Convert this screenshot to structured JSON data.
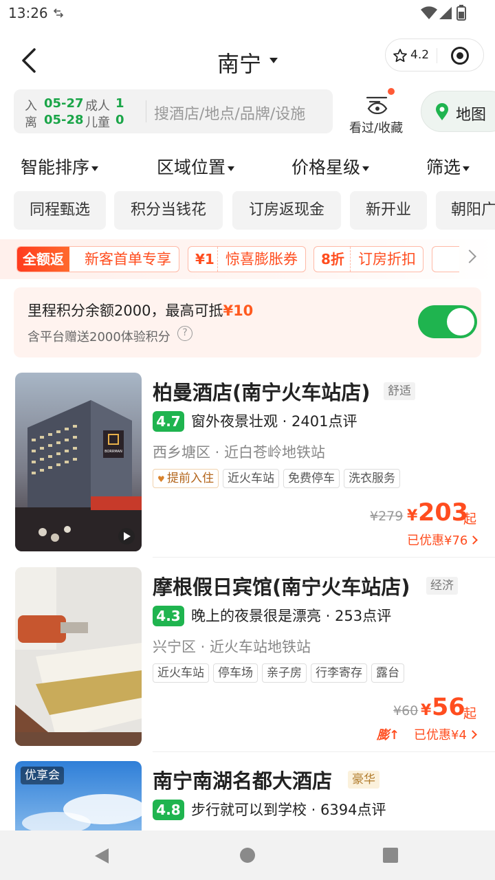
{
  "status_bar": {
    "time": "13:26"
  },
  "header": {
    "city": "南宁",
    "rating": "4.2"
  },
  "search": {
    "checkin_label": "入",
    "checkin_date": "05-27",
    "checkout_label": "离",
    "checkout_date": "05-28",
    "adult_label": "成人",
    "adult_count": "1",
    "child_label": "儿童",
    "child_count": "0",
    "placeholder": "搜酒店/地点/品牌/设施"
  },
  "favorites": {
    "label": "看过/收藏"
  },
  "map": {
    "label": "地图"
  },
  "sort_bar": [
    {
      "label": "智能排序"
    },
    {
      "label": "区域位置"
    },
    {
      "label": "价格星级"
    },
    {
      "label": "筛选"
    }
  ],
  "chips": [
    {
      "label": "同程甄选"
    },
    {
      "label": "积分当钱花"
    },
    {
      "label": "订房返现金"
    },
    {
      "label": "新开业"
    },
    {
      "label": "朝阳广"
    }
  ],
  "promos": [
    {
      "badge": "全额返",
      "text": "新客首单专享"
    },
    {
      "badge": "¥1",
      "text": "惊喜膨胀券"
    },
    {
      "badge": "8折",
      "text": "订房折扣"
    }
  ],
  "points": {
    "text_prefix": "里程积分余额2000，最高可抵",
    "highlight": "¥10",
    "sub": "含平台赠送2000体验积分",
    "toggle_on": true
  },
  "hotels": [
    {
      "name": "柏曼酒店(南宁火车站店)",
      "tier": "舒适",
      "score": "4.7",
      "review": "窗外夜景壮观 · 2401点评",
      "location": "西乡塘区 · 近白苍岭地铁站",
      "tags": [
        "提前入住",
        "近火车站",
        "免费停车",
        "洗衣服务"
      ],
      "orig_price": "¥279",
      "currency": "¥",
      "price": "203",
      "price_suffix": "起",
      "saved": "已优惠¥76",
      "sign_text": "BORRMAN"
    },
    {
      "name": "摩根假日宾馆(南宁火车站店)",
      "tier": "经济",
      "score": "4.3",
      "review": "晚上的夜景很是漂亮 · 253点评",
      "location": "兴宁区 · 近火车站地铁站",
      "tags": [
        "近火车站",
        "停车场",
        "亲子房",
        "行李寄存",
        "露台"
      ],
      "orig_price": "¥60",
      "currency": "¥",
      "price": "56",
      "price_suffix": "起",
      "pengz": "膨↑",
      "saved": "已优惠¥4"
    },
    {
      "name": "南宁南湖名都大酒店",
      "tier": "豪华",
      "score": "4.8",
      "review": "步行就可以到学校 · 6394点评",
      "badge": "优享会"
    }
  ]
}
